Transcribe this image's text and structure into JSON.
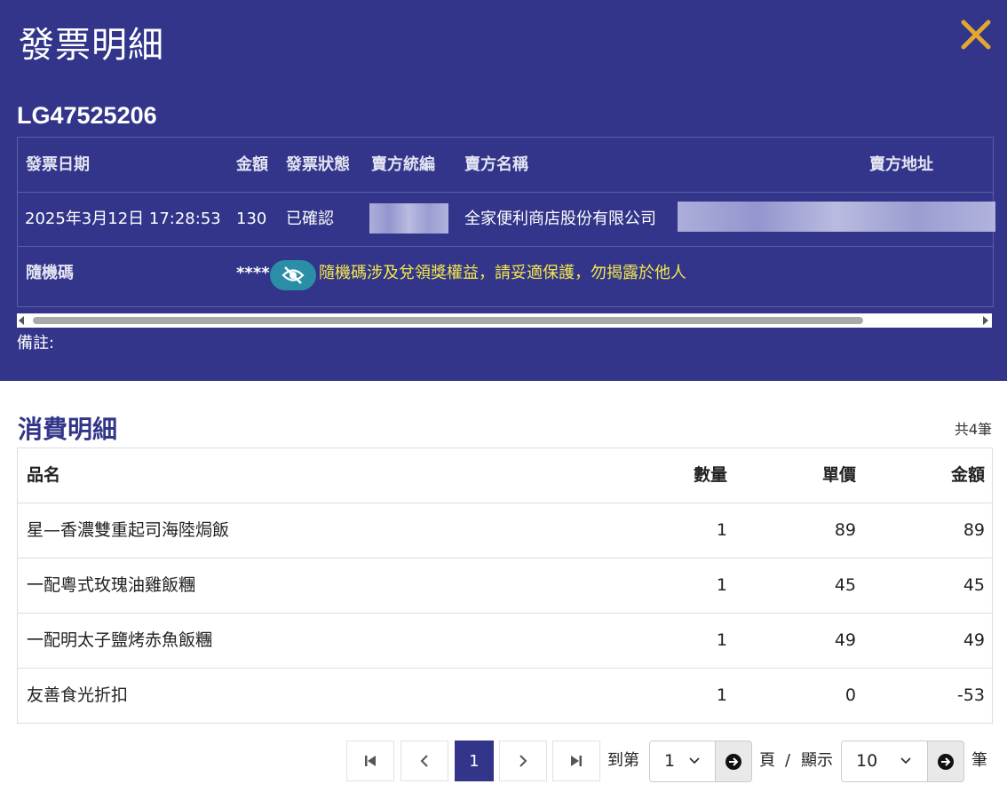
{
  "header": {
    "title": "發票明細",
    "invoice_no": "LG47525206",
    "columns": [
      "發票日期",
      "金額",
      "發票狀態",
      "賣方統編",
      "賣方名稱",
      "賣方地址"
    ],
    "values": {
      "date": "2025年3月12日 17:28:53",
      "amount": "130",
      "status": "已確認",
      "seller_name": "全家便利商店股份有限公司"
    },
    "random_code_label": "隨機碼",
    "random_code": "****",
    "warning": "隨機碼涉及兌領獎權益，請妥適保護，勿揭露於他人",
    "memo_label": "備註:"
  },
  "details": {
    "title": "消費明細",
    "count": "共4筆",
    "columns": [
      "品名",
      "數量",
      "單價",
      "金額"
    ],
    "rows": [
      [
        "星—香濃雙重起司海陸焗飯",
        "1",
        "89",
        "89"
      ],
      [
        "一配粵式玫瑰油雞飯糰",
        "1",
        "45",
        "45"
      ],
      [
        "一配明太子鹽烤赤魚飯糰",
        "1",
        "49",
        "49"
      ],
      [
        "友善食光折扣",
        "1",
        "0",
        "-53"
      ]
    ]
  },
  "pager": {
    "current_page": "1",
    "goto_label": "到第",
    "page_select": "1",
    "page_label": "頁",
    "separator": "/",
    "show_label": "顯示",
    "size_select": "10",
    "unit_label": "筆"
  },
  "colors": {
    "header_bg": "#32358a",
    "close": "#e0a830",
    "warning": "#f5e94a",
    "eye_btn": "#2a8fa6"
  }
}
